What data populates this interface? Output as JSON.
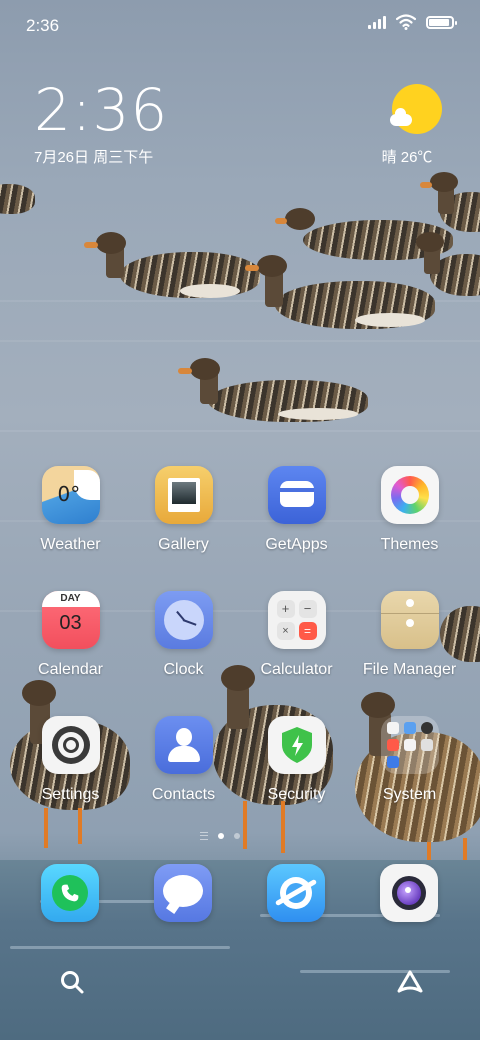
{
  "status_bar": {
    "time": "2:36",
    "battery_level": 0.85
  },
  "clock_widget": {
    "time": "2:36",
    "date": "7月26日 周三下午"
  },
  "weather_widget": {
    "text": "晴 26℃",
    "icon": "sunny-cloud-icon"
  },
  "apps": [
    {
      "label": "Weather",
      "icon": "weather-icon",
      "badge_text": "0°"
    },
    {
      "label": "Gallery",
      "icon": "gallery-icon"
    },
    {
      "label": "GetApps",
      "icon": "getapps-icon"
    },
    {
      "label": "Themes",
      "icon": "themes-icon"
    },
    {
      "label": "Calendar",
      "icon": "calendar-icon",
      "day_header": "DAY",
      "day_number": "03"
    },
    {
      "label": "Clock",
      "icon": "clock-icon"
    },
    {
      "label": "Calculator",
      "icon": "calculator-icon"
    },
    {
      "label": "File Manager",
      "icon": "file-manager-icon"
    },
    {
      "label": "Settings",
      "icon": "settings-icon"
    },
    {
      "label": "Contacts",
      "icon": "contacts-icon"
    },
    {
      "label": "Security",
      "icon": "security-icon"
    },
    {
      "label": "System",
      "icon": "system-folder-icon"
    }
  ],
  "dock": [
    {
      "icon": "phone-icon"
    },
    {
      "icon": "messages-icon"
    },
    {
      "icon": "browser-icon"
    },
    {
      "icon": "camera-icon"
    }
  ],
  "bottom_bar": {
    "left_icon": "search-icon",
    "right_icon": "app-vault-icon"
  },
  "colors": {
    "sun": "#ffd21f",
    "phone": "#1fc15a",
    "security": "#3fc24a"
  }
}
